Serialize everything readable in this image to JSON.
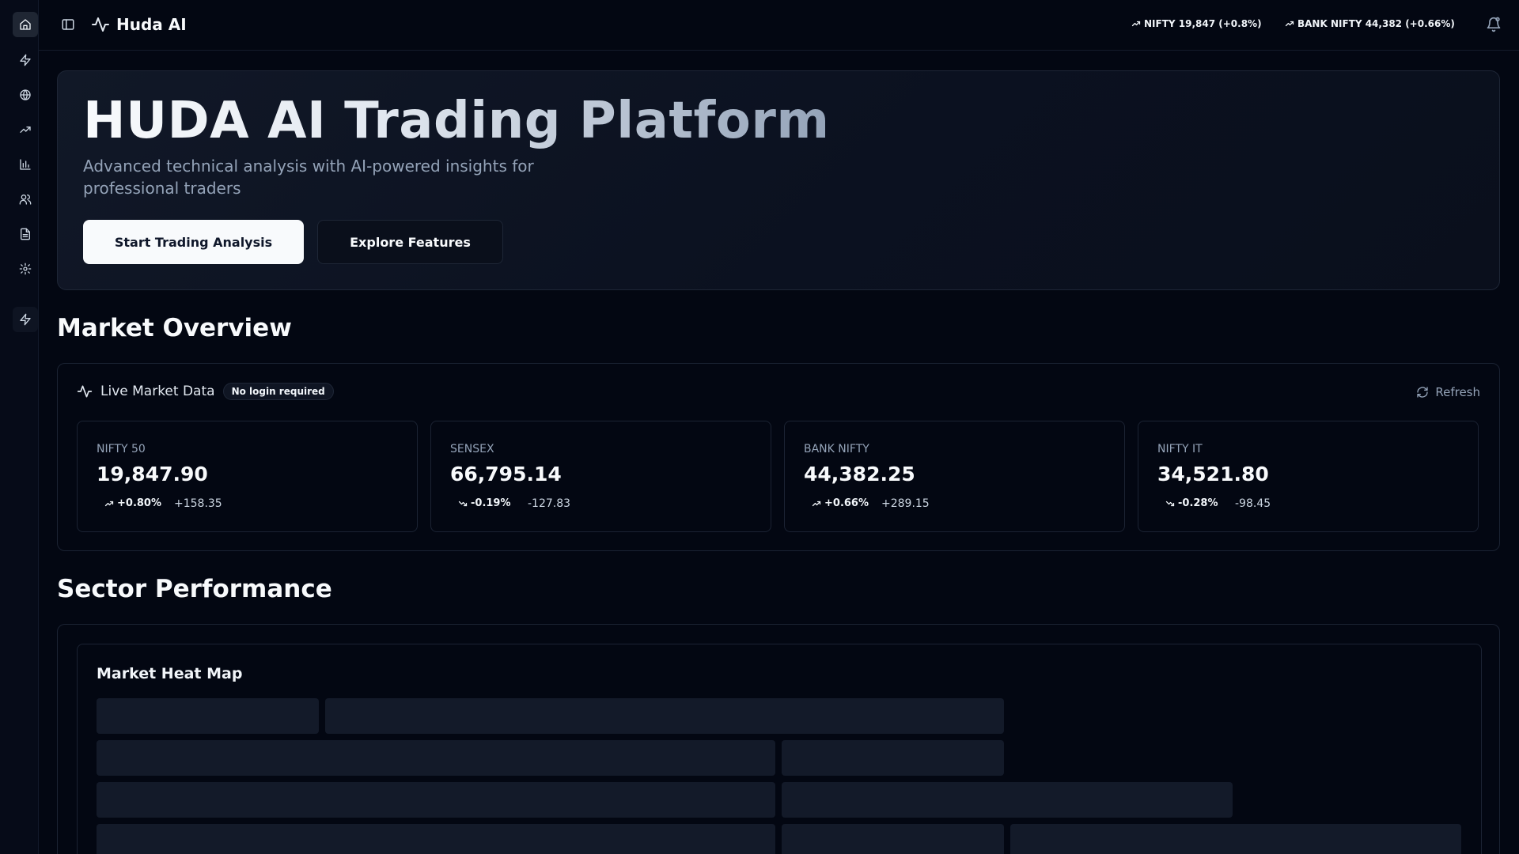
{
  "app": {
    "name": "Huda AI"
  },
  "sidebar": {
    "items": [
      {
        "icon": "home-icon",
        "active": true
      },
      {
        "icon": "zap-icon"
      },
      {
        "icon": "globe-icon"
      },
      {
        "icon": "trending-up-icon"
      },
      {
        "icon": "bar-chart-icon"
      },
      {
        "icon": "users-icon"
      },
      {
        "icon": "document-icon"
      },
      {
        "icon": "settings-icon"
      },
      {
        "icon": "zap-icon"
      }
    ]
  },
  "header": {
    "tickers": [
      {
        "label": "NIFTY 19,847 (+0.8%)",
        "direction": "up"
      },
      {
        "label": "BANK NIFTY 44,382 (+0.66%)",
        "direction": "up"
      }
    ]
  },
  "hero": {
    "title": "HUDA AI Trading Platform",
    "subtitle": "Advanced technical analysis with AI-powered insights for professional traders",
    "primary_button": "Start Trading Analysis",
    "secondary_button": "Explore Features"
  },
  "market_overview": {
    "section_title": "Market Overview",
    "card_title": "Live Market Data",
    "badge": "No login required",
    "refresh_label": "Refresh",
    "indices": [
      {
        "name": "NIFTY 50",
        "value": "19,847.90",
        "change_pct": "+0.80%",
        "change_abs": "+158.35",
        "direction": "up"
      },
      {
        "name": "SENSEX",
        "value": "66,795.14",
        "change_pct": "-0.19%",
        "change_abs": "-127.83",
        "direction": "down"
      },
      {
        "name": "BANK NIFTY",
        "value": "44,382.25",
        "change_pct": "+0.66%",
        "change_abs": "+289.15",
        "direction": "up"
      },
      {
        "name": "NIFTY IT",
        "value": "34,521.80",
        "change_pct": "-0.28%",
        "change_abs": "-98.45",
        "direction": "down"
      }
    ]
  },
  "sector_performance": {
    "section_title": "Sector Performance",
    "heatmap_title": "Market Heat Map"
  },
  "colors": {
    "background": "#030712",
    "card_border": "#1b2333",
    "heat_placeholder": "#131a29",
    "primary_button_bg": "#f8fafc",
    "muted_text": "#94a3b8"
  }
}
